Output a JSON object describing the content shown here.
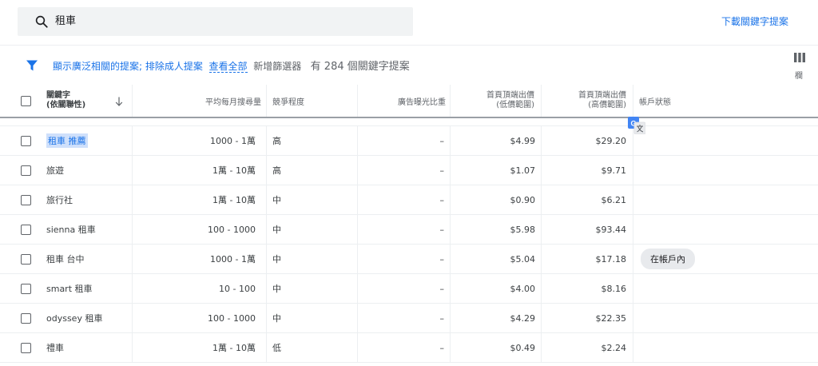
{
  "search": {
    "query": "租車",
    "icon": "search-icon"
  },
  "download_label": "下載關鍵字提案",
  "filter": {
    "icon": "filter-icon",
    "show_broad": "顯示廣泛相關的提案",
    "separator": ";",
    "exclude_adult": "排除成人提案",
    "view_all": "查看全部",
    "add_filter": "新增篩選器",
    "count_text": "有 284 個關鍵字提案"
  },
  "columns_button": {
    "icon": "columns-icon",
    "label": "欄"
  },
  "table": {
    "headers": {
      "keyword_line1": "關鍵字",
      "keyword_line2": "(依關聯性)",
      "avg_searches": "平均每月搜尋量",
      "competition": "競爭程度",
      "impression_share": "廣告曝光比重",
      "low_bid_line1": "首頁頂端出價",
      "low_bid_line2": "(低價範圍)",
      "high_bid_line1": "首頁頂端出價",
      "high_bid_line2": "(高價範圍)",
      "account_status": "帳戶狀態"
    },
    "rows": [
      {
        "keyword": "租車 推薦",
        "searches": "1000 - 1萬",
        "competition": "高",
        "impression": "–",
        "low_bid": "$4.99",
        "high_bid": "$29.20",
        "status": ""
      },
      {
        "keyword": "旅遊",
        "searches": "1萬 - 10萬",
        "competition": "高",
        "impression": "–",
        "low_bid": "$1.07",
        "high_bid": "$9.71",
        "status": ""
      },
      {
        "keyword": "旅行社",
        "searches": "1萬 - 10萬",
        "competition": "中",
        "impression": "–",
        "low_bid": "$0.90",
        "high_bid": "$6.21",
        "status": ""
      },
      {
        "keyword": "sienna 租車",
        "searches": "100 - 1000",
        "competition": "中",
        "impression": "–",
        "low_bid": "$5.98",
        "high_bid": "$93.44",
        "status": ""
      },
      {
        "keyword": "租車 台中",
        "searches": "1000 - 1萬",
        "competition": "中",
        "impression": "–",
        "low_bid": "$5.04",
        "high_bid": "$17.18",
        "status": "在帳戶內"
      },
      {
        "keyword": "smart 租車",
        "searches": "10 - 100",
        "competition": "中",
        "impression": "–",
        "low_bid": "$4.00",
        "high_bid": "$8.16",
        "status": ""
      },
      {
        "keyword": "odyssey 租車",
        "searches": "100 - 1000",
        "competition": "中",
        "impression": "–",
        "low_bid": "$4.29",
        "high_bid": "$22.35",
        "status": ""
      },
      {
        "keyword": "禮車",
        "searches": "1萬 - 10萬",
        "competition": "低",
        "impression": "–",
        "low_bid": "$0.49",
        "high_bid": "$2.24",
        "status": ""
      }
    ]
  },
  "colors": {
    "link": "#1a73e8",
    "selection": "#cfe0fb",
    "search_bg": "#f1f3f4",
    "badge_bg": "#e8eaed"
  }
}
